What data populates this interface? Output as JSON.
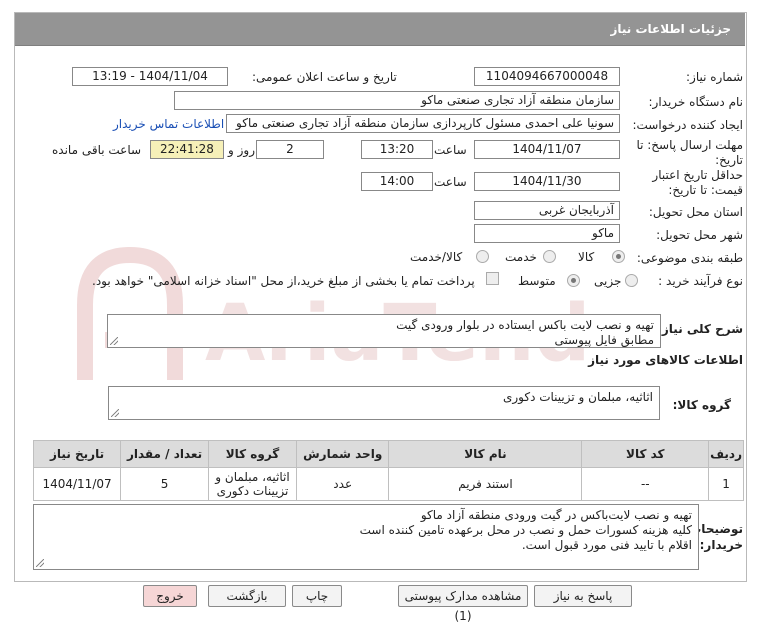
{
  "header": {
    "title": "جزئیات اطلاعات نیاز"
  },
  "form": {
    "need_number_label": "شماره نیاز:",
    "need_number": "1104094667000048",
    "announce_label": "تاریخ و ساعت اعلان عمومی:",
    "announce_value": "1404/11/04 - 13:19",
    "buyer_org_label": "نام دستگاه خریدار:",
    "buyer_org": "سازمان منطقه آزاد تجاری   صنعتی ماکو",
    "creator_label": "ایجاد کننده درخواست:",
    "creator": "سونیا علی احمدی مسئول کارپردازی سازمان منطقه آزاد تجاری   صنعتی ماکو",
    "contact_link": "اطلاعات تماس خریدار",
    "deadline_label_1": "مهلت ارسال پاسخ: تا",
    "deadline_label_2": "تاریخ:",
    "deadline_date": "1404/11/07",
    "time_label": "ساعت",
    "deadline_time": "13:20",
    "days_value": "2",
    "days_label": "روز و",
    "remaining_time": "22:41:28",
    "remaining_label": "ساعت باقی مانده",
    "validity_label_1": "حداقل تاریخ اعتبار",
    "validity_label_2": "قیمت: تا تاریخ:",
    "validity_date": "1404/11/30",
    "validity_time": "14:00",
    "province_label": "استان محل تحویل:",
    "province": "آذربایجان غربی",
    "city_label": "شهر محل تحویل:",
    "city": "ماکو",
    "category_label": "طبقه بندی موضوعی:",
    "category_options": [
      "کالا",
      "خدمت",
      "کالا/خدمت"
    ],
    "category_selected": "کالا",
    "purchase_type_label": "نوع فرآیند خرید :",
    "purchase_options": [
      "جزیی",
      "متوسط"
    ],
    "purchase_selected": "جزیی",
    "treasury_note": "پرداخت تمام یا بخشی از مبلغ خرید،از محل \"اسناد خزانه اسلامی\" خواهد بود."
  },
  "summary": {
    "label": "شرح کلی نیاز:",
    "text_line1": "تهیه و نصب لایت باکس ایستاده در بلوار ورودی گیت",
    "text_line2": "مطابق فایل پیوستی"
  },
  "goods": {
    "section_title": "اطلاعات کالاهای مورد نیاز",
    "group_label": "گروه کالا:",
    "group_value": "اثاثیه، مبلمان و تزیینات دکوری"
  },
  "table": {
    "headers": [
      "ردیف",
      "کد کالا",
      "نام کالا",
      "واحد شمارش",
      "گروه کالا",
      "تعداد / مقدار",
      "تاریخ نیاز"
    ],
    "rows": [
      {
        "row": "1",
        "code": "--",
        "name": "استند فریم",
        "unit": "عدد",
        "group_line1": "اثاثیه، مبلمان و",
        "group_line2": "تزیینات دکوری",
        "qty": "5",
        "date": "1404/11/07"
      }
    ]
  },
  "notes": {
    "label_1": "توضیحات",
    "label_2": "خریدار:",
    "line1": "تهیه و نصب  لایت‌باکس در گیت ورودی منطقه آزاد ماکو",
    "line2": "کلیه هزینه کسورات حمل و نصب در محل برعهده تامین کننده است",
    "line3": "اقلام با تایید فنی مورد قبول است."
  },
  "buttons": {
    "reply": "پاسخ به نیاز",
    "attachments": "مشاهده مدارک پیوستی (1)",
    "print": "چاپ",
    "back": "بازگشت",
    "exit": "خروج"
  },
  "colors": {
    "title_bar": "#949494",
    "highlight": "#f6f0b8",
    "link": "#1a4fb5",
    "exit_button": "#f6d6d6"
  }
}
